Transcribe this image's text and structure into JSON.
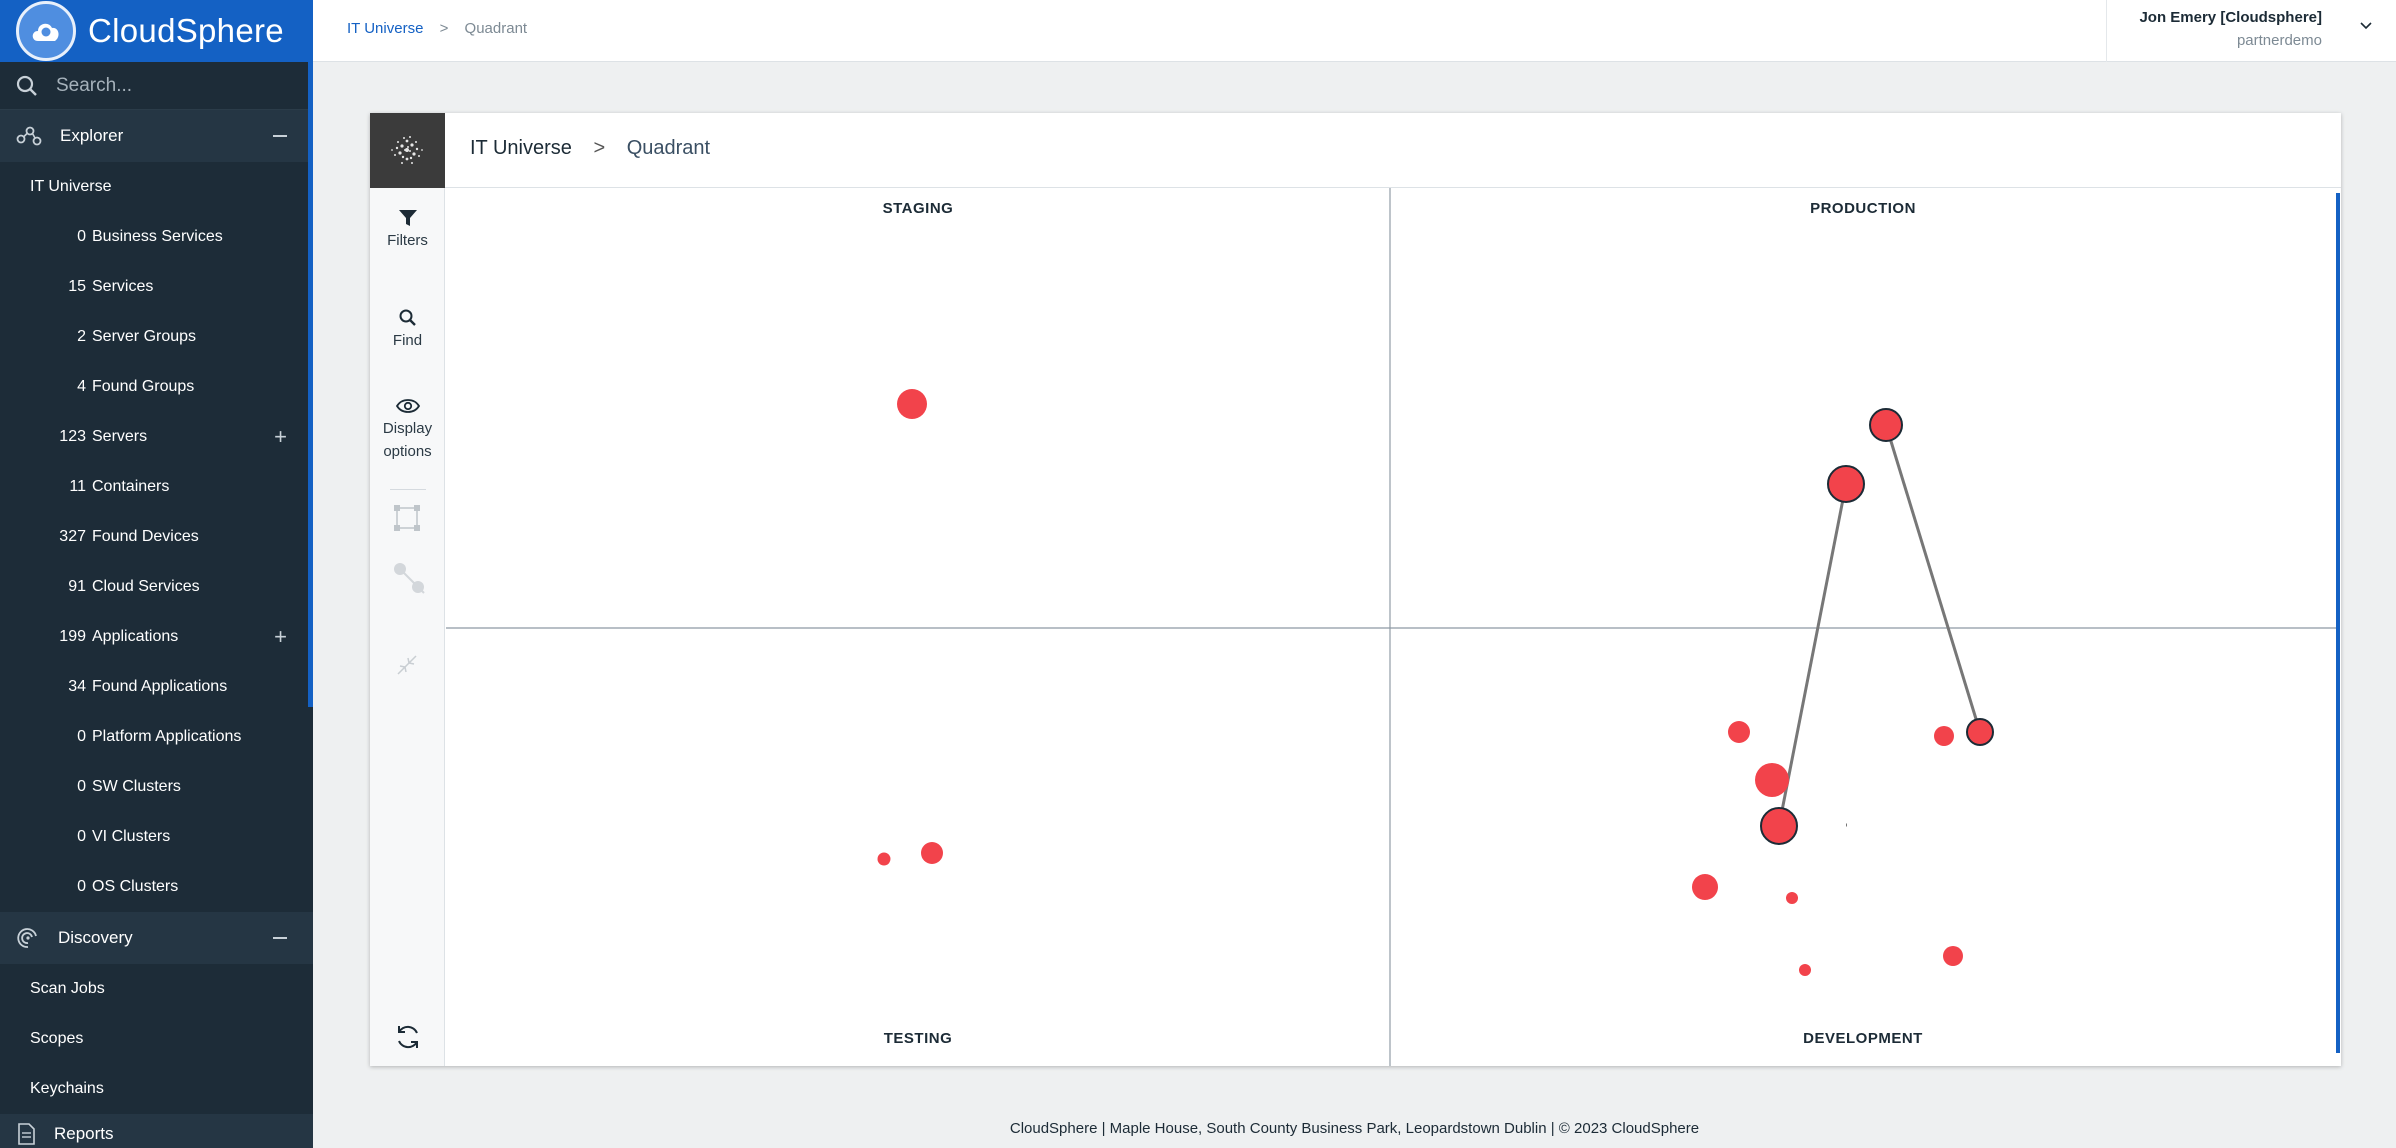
{
  "app": {
    "logo_text": "CloudSphere"
  },
  "search": {
    "placeholder": "Search..."
  },
  "sidebar": {
    "explorer": {
      "label": "Explorer"
    },
    "explorer_items": [
      {
        "count": "",
        "label": "IT Universe"
      },
      {
        "count": "0",
        "label": "Business Services"
      },
      {
        "count": "15",
        "label": "Services"
      },
      {
        "count": "2",
        "label": "Server Groups"
      },
      {
        "count": "4",
        "label": "Found Groups"
      },
      {
        "count": "123",
        "label": "Servers"
      },
      {
        "count": "11",
        "label": "Containers"
      },
      {
        "count": "327",
        "label": "Found Devices"
      },
      {
        "count": "91",
        "label": "Cloud Services"
      },
      {
        "count": "199",
        "label": "Applications"
      },
      {
        "count": "34",
        "label": "Found Applications"
      },
      {
        "count": "0",
        "label": "Platform Applications"
      },
      {
        "count": "0",
        "label": "SW Clusters"
      },
      {
        "count": "0",
        "label": "VI Clusters"
      },
      {
        "count": "0",
        "label": "OS Clusters"
      }
    ],
    "discovery": {
      "label": "Discovery"
    },
    "discovery_items": [
      {
        "label": "Scan Jobs"
      },
      {
        "label": "Scopes"
      },
      {
        "label": "Keychains"
      }
    ],
    "reports": {
      "label": "Reports"
    }
  },
  "topbar": {
    "breadcrumb_root": "IT Universe",
    "breadcrumb_sep": ">",
    "breadcrumb_current": "Quadrant",
    "user_name": "Jon Emery [Cloudsphere]",
    "user_org": "partnerdemo"
  },
  "card": {
    "title_root": "IT Universe",
    "title_sep": ">",
    "title_current": "Quadrant"
  },
  "toolbar": {
    "filters": "Filters",
    "find": "Find",
    "display_line1": "Display",
    "display_line2": "options"
  },
  "quadrants": {
    "top_left": "STAGING",
    "top_right": "PRODUCTION",
    "bottom_left": "TESTING",
    "bottom_right": "DEVELOPMENT"
  },
  "footer": {
    "text": "CloudSphere | Maple House, South County Business Park, Leopardstown Dublin | © 2023 CloudSphere"
  },
  "colors": {
    "brand": "#1461c4",
    "sidebar": "#1d2c38",
    "node": "#f2434b",
    "link": "#777777"
  }
}
